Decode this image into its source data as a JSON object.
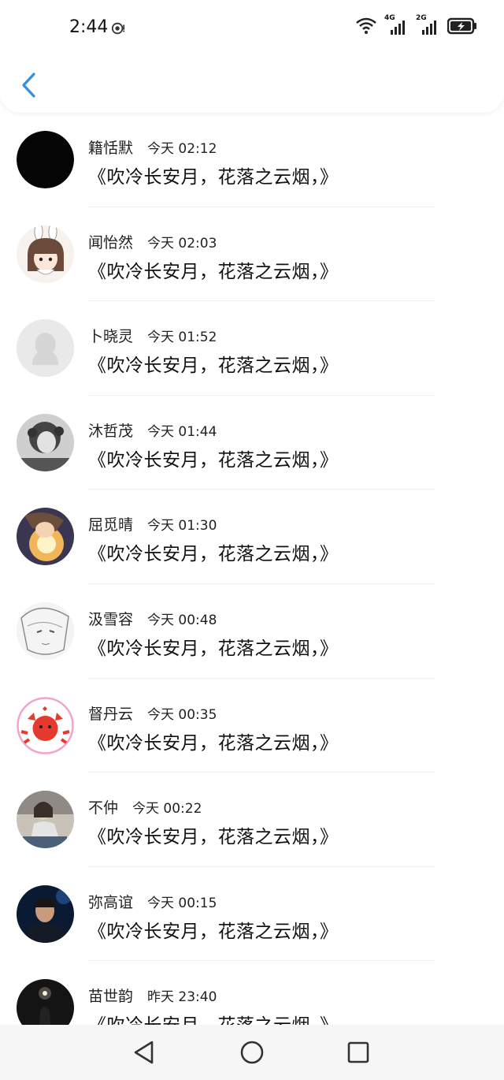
{
  "status_bar": {
    "time": "2:44",
    "net_primary": "4G",
    "net_secondary": "2G"
  },
  "header": {
    "back_icon": "chevron-left-icon",
    "accent_color": "#2f8fe0"
  },
  "comments": [
    {
      "name": "籍恬默",
      "time": "今天 02:12",
      "text": "《吹冷长安月，花落之云烟，》",
      "avatar": "black-circle"
    },
    {
      "name": "闻怡然",
      "time": "今天 02:03",
      "text": "《吹冷长安月，花落之云烟，》",
      "avatar": "bunny-girl"
    },
    {
      "name": "卜晓灵",
      "time": "今天 01:52",
      "text": "《吹冷长安月，花落之云烟，》",
      "avatar": "default-penguin"
    },
    {
      "name": "沐哲茂",
      "time": "今天 01:44",
      "text": "《吹冷长安月，花落之云烟，》",
      "avatar": "child-photo"
    },
    {
      "name": "屈觅晴",
      "time": "今天 01:30",
      "text": "《吹冷长安月，花落之云烟，》",
      "avatar": "anime-glow"
    },
    {
      "name": "汲雪容",
      "time": "今天 00:48",
      "text": "《吹冷长安月，花落之云烟，》",
      "avatar": "sketch-face"
    },
    {
      "name": "督丹云",
      "time": "今天 00:35",
      "text": "《吹冷长安月，花落之云烟，》",
      "avatar": "red-crab"
    },
    {
      "name": "不仲",
      "time": "今天 00:22",
      "text": "《吹冷长安月，花落之云烟，》",
      "avatar": "sitting-person"
    },
    {
      "name": "弥高谊",
      "time": "今天 00:15",
      "text": "《吹冷长安月，花落之云烟，》",
      "avatar": "man-portrait"
    },
    {
      "name": "苗世韵",
      "time": "昨天 23:40",
      "text": "《吹冷长安月，花落之云烟，》",
      "avatar": "dark-light"
    }
  ],
  "nav_bar": {
    "back": "triangle-back-icon",
    "home": "circle-home-icon",
    "recents": "square-recents-icon"
  }
}
